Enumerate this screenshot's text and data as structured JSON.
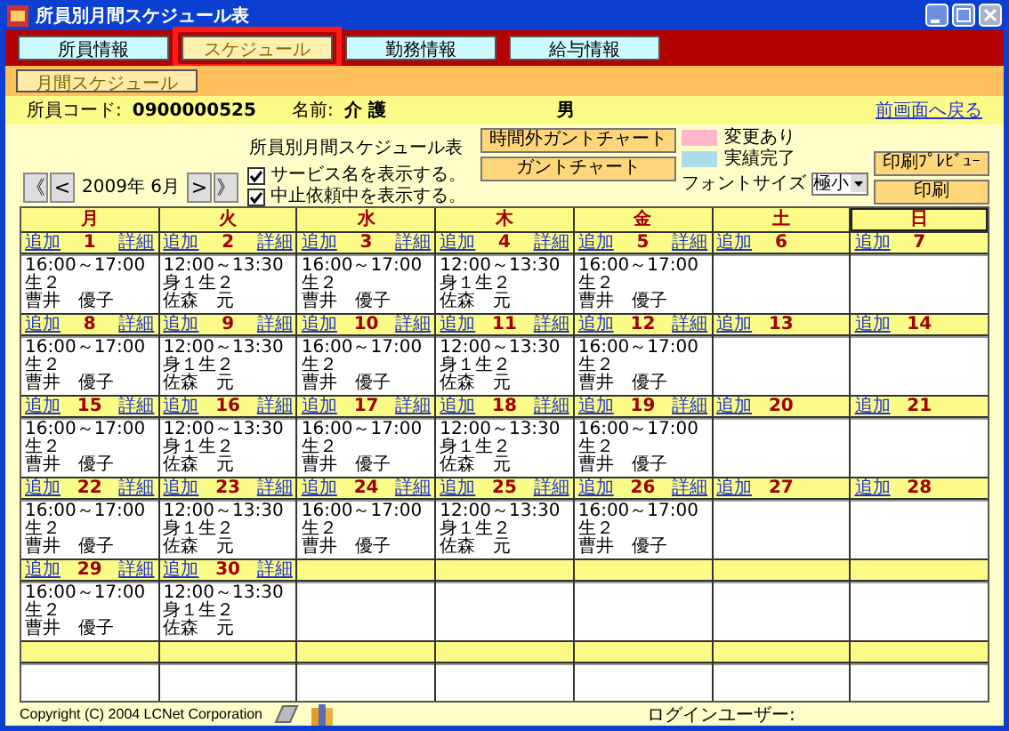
{
  "window": {
    "title": "所員別月間スケジュール表"
  },
  "tabs": [
    {
      "label": "所員情報",
      "selected": false
    },
    {
      "label": "スケジュール",
      "selected": true
    },
    {
      "label": "勤務情報",
      "selected": false
    },
    {
      "label": "給与情報",
      "selected": false
    }
  ],
  "subtabs": [
    {
      "label": "月間スケジュール",
      "selected": true
    }
  ],
  "staff": {
    "code_label": "所員コード:",
    "code": "0900000525",
    "name_label": "名前:",
    "name": "介 護",
    "gender": "男",
    "back_link": "前画面へ戻る"
  },
  "page_title": "所員別月間スケジュール表",
  "nav": {
    "first": "《",
    "prev": "<",
    "month": "2009年 6月",
    "next": ">",
    "last": "》"
  },
  "options": [
    {
      "label": "サービス名を表示する。",
      "checked": true
    },
    {
      "label": "中止依頼中を表示する。",
      "checked": true
    }
  ],
  "chart_buttons": [
    "時間外ガントチャート",
    "ガントチャート"
  ],
  "legend": [
    {
      "label": "変更あり",
      "color": "#ffb6c8"
    },
    {
      "label": "実績完了",
      "color": "#acdcec"
    }
  ],
  "font_size": {
    "label": "フォントサイズ",
    "value": "極小"
  },
  "print_buttons": [
    "印刷ﾌﾟﾚﾋﾞｭｰ",
    "印刷"
  ],
  "weekdays": [
    {
      "label": "月",
      "selected": false
    },
    {
      "label": "火",
      "selected": false
    },
    {
      "label": "水",
      "selected": false
    },
    {
      "label": "木",
      "selected": false
    },
    {
      "label": "金",
      "selected": false
    },
    {
      "label": "土",
      "selected": false
    },
    {
      "label": "日",
      "selected": true
    }
  ],
  "weeks": [
    [
      {
        "kind": "day",
        "day": "1",
        "add": "追加",
        "detail": "詳細",
        "entries": [
          {
            "time": "16:00～17:00生２",
            "name": "曹井　優子"
          }
        ]
      },
      {
        "kind": "day",
        "day": "2",
        "add": "追加",
        "detail": "詳細",
        "entries": [
          {
            "time": "12:00～13:30身１生２",
            "name": "佐森　元"
          }
        ]
      },
      {
        "kind": "day",
        "day": "3",
        "add": "追加",
        "detail": "詳細",
        "entries": [
          {
            "time": "16:00～17:00生２",
            "name": "曹井　優子"
          }
        ]
      },
      {
        "kind": "day",
        "day": "4",
        "add": "追加",
        "detail": "詳細",
        "entries": [
          {
            "time": "12:00～13:30身１生２",
            "name": "佐森　元"
          }
        ]
      },
      {
        "kind": "day",
        "day": "5",
        "add": "追加",
        "detail": "詳細",
        "entries": [
          {
            "time": "16:00～17:00生２",
            "name": "曹井　優子"
          }
        ]
      },
      {
        "kind": "day",
        "day": "6",
        "add": "追加"
      },
      {
        "kind": "day",
        "day": "7",
        "add": "追加"
      }
    ],
    [
      {
        "kind": "day",
        "day": "8",
        "add": "追加",
        "detail": "詳細",
        "entries": [
          {
            "time": "16:00～17:00生２",
            "name": "曹井　優子"
          }
        ]
      },
      {
        "kind": "day",
        "day": "9",
        "add": "追加",
        "detail": "詳細",
        "entries": [
          {
            "time": "12:00～13:30身１生２",
            "name": "佐森　元"
          }
        ]
      },
      {
        "kind": "day",
        "day": "10",
        "add": "追加",
        "detail": "詳細",
        "entries": [
          {
            "time": "16:00～17:00生２",
            "name": "曹井　優子"
          }
        ]
      },
      {
        "kind": "day",
        "day": "11",
        "add": "追加",
        "detail": "詳細",
        "entries": [
          {
            "time": "12:00～13:30身１生２",
            "name": "佐森　元"
          }
        ]
      },
      {
        "kind": "day",
        "day": "12",
        "add": "追加",
        "detail": "詳細",
        "entries": [
          {
            "time": "16:00～17:00生２",
            "name": "曹井　優子"
          }
        ]
      },
      {
        "kind": "day",
        "day": "13",
        "add": "追加"
      },
      {
        "kind": "day",
        "day": "14",
        "add": "追加"
      }
    ],
    [
      {
        "kind": "day",
        "day": "15",
        "add": "追加",
        "detail": "詳細",
        "entries": [
          {
            "time": "16:00～17:00生２",
            "name": "曹井　優子"
          }
        ]
      },
      {
        "kind": "day",
        "day": "16",
        "add": "追加",
        "detail": "詳細",
        "entries": [
          {
            "time": "12:00～13:30身１生２",
            "name": "佐森　元"
          }
        ]
      },
      {
        "kind": "day",
        "day": "17",
        "add": "追加",
        "detail": "詳細",
        "entries": [
          {
            "time": "16:00～17:00生２",
            "name": "曹井　優子"
          }
        ]
      },
      {
        "kind": "day",
        "day": "18",
        "add": "追加",
        "detail": "詳細",
        "entries": [
          {
            "time": "12:00～13:30身１生２",
            "name": "佐森　元"
          }
        ]
      },
      {
        "kind": "day",
        "day": "19",
        "add": "追加",
        "detail": "詳細",
        "entries": [
          {
            "time": "16:00～17:00生２",
            "name": "曹井　優子"
          }
        ]
      },
      {
        "kind": "day",
        "day": "20",
        "add": "追加"
      },
      {
        "kind": "day",
        "day": "21",
        "add": "追加"
      }
    ],
    [
      {
        "kind": "day",
        "day": "22",
        "add": "追加",
        "detail": "詳細",
        "entries": [
          {
            "time": "16:00～17:00生２",
            "name": "曹井　優子"
          }
        ]
      },
      {
        "kind": "day",
        "day": "23",
        "add": "追加",
        "detail": "詳細",
        "entries": [
          {
            "time": "12:00～13:30身１生２",
            "name": "佐森　元"
          }
        ]
      },
      {
        "kind": "day",
        "day": "24",
        "add": "追加",
        "detail": "詳細",
        "entries": [
          {
            "time": "16:00～17:00生２",
            "name": "曹井　優子"
          }
        ]
      },
      {
        "kind": "day",
        "day": "25",
        "add": "追加",
        "detail": "詳細",
        "entries": [
          {
            "time": "12:00～13:30身１生２",
            "name": "佐森　元"
          }
        ]
      },
      {
        "kind": "day",
        "day": "26",
        "add": "追加",
        "detail": "詳細",
        "entries": [
          {
            "time": "16:00～17:00生２",
            "name": "曹井　優子"
          }
        ]
      },
      {
        "kind": "day",
        "day": "27",
        "add": "追加"
      },
      {
        "kind": "day",
        "day": "28",
        "add": "追加"
      }
    ],
    [
      {
        "kind": "day",
        "day": "29",
        "add": "追加",
        "detail": "詳細",
        "entries": [
          {
            "time": "16:00～17:00生２",
            "name": "曹井　優子"
          }
        ]
      },
      {
        "kind": "day",
        "day": "30",
        "add": "追加",
        "detail": "詳細",
        "entries": [
          {
            "time": "12:00～13:30身１生２",
            "name": "佐森　元"
          }
        ]
      },
      {
        "kind": "empty"
      },
      {
        "kind": "empty"
      },
      {
        "kind": "empty"
      },
      {
        "kind": "empty"
      },
      {
        "kind": "empty"
      }
    ],
    [
      {
        "kind": "empty"
      },
      {
        "kind": "empty"
      },
      {
        "kind": "empty"
      },
      {
        "kind": "empty"
      },
      {
        "kind": "empty"
      },
      {
        "kind": "empty"
      },
      {
        "kind": "empty"
      }
    ]
  ],
  "footer": {
    "copyright": "Copyright (C) 2004 LCNet Corporation",
    "login_label": "ログインユーザー:"
  }
}
